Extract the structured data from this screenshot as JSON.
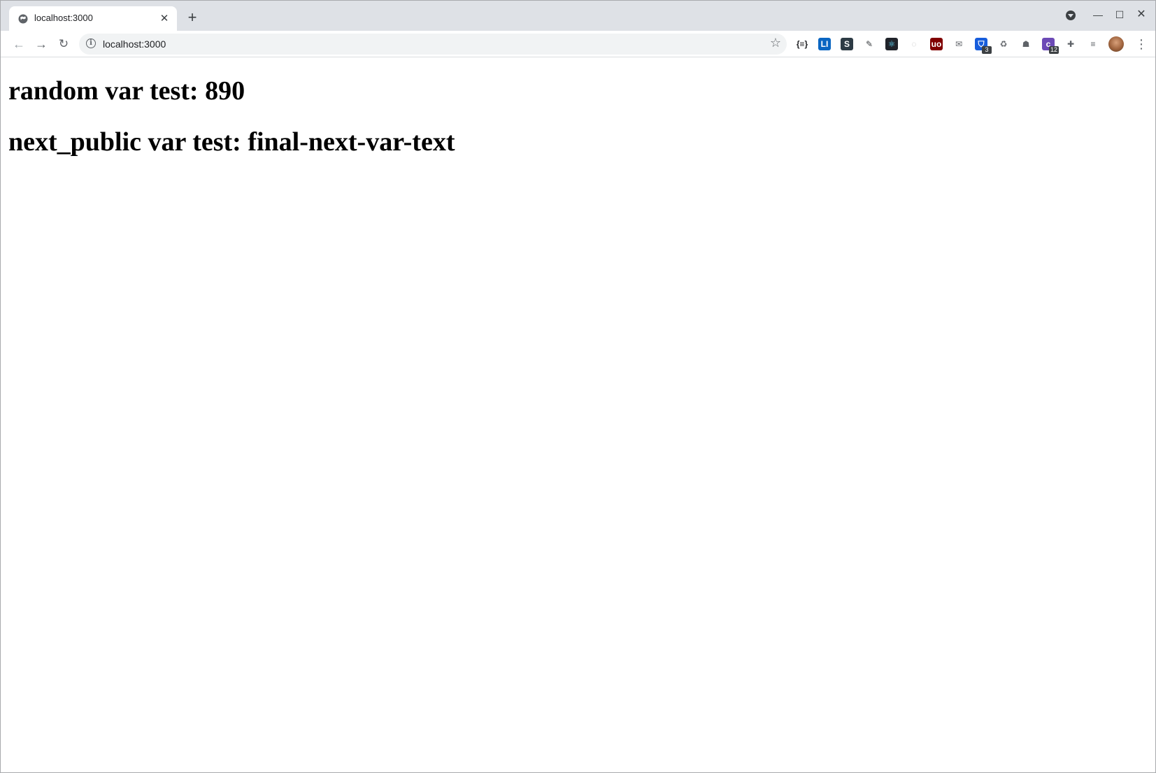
{
  "browser": {
    "tab": {
      "title": "localhost:3000",
      "close_glyph": "✕"
    },
    "new_tab_glyph": "+",
    "window_controls": {
      "minimize_glyph": "—",
      "maximize_glyph": "☐",
      "close_glyph": "✕"
    },
    "toolbar": {
      "back_glyph": "←",
      "forward_glyph": "→",
      "reload_glyph": "↻",
      "url": "localhost:3000",
      "star_glyph": "☆",
      "menu_glyph": "⋮"
    },
    "extensions": [
      {
        "name": "json-viewer-icon",
        "label": "{≡}",
        "bg": "#ffffff",
        "fg": "#202124"
      },
      {
        "name": "li-extension-icon",
        "label": "LI",
        "bg": "#0a66c2",
        "fg": "#ffffff"
      },
      {
        "name": "s-extension-icon",
        "label": "S",
        "bg": "#2d3b45",
        "fg": "#ffffff"
      },
      {
        "name": "dropper-extension-icon",
        "label": "✎",
        "bg": "#ffffff",
        "fg": "#3c4043"
      },
      {
        "name": "react-devtools-icon",
        "label": "⚛",
        "bg": "#20232a",
        "fg": "#61dafb"
      },
      {
        "name": "circle-extension-icon",
        "label": "◌",
        "bg": "#ffffff",
        "fg": "#bdbdbd"
      },
      {
        "name": "ublock-icon",
        "label": "uo",
        "bg": "#800000",
        "fg": "#ffffff"
      },
      {
        "name": "mail-extension-icon",
        "label": "✉",
        "bg": "#ffffff",
        "fg": "#5f6368"
      },
      {
        "name": "bitwarden-icon",
        "label": "⛉",
        "bg": "#175ddc",
        "fg": "#ffffff",
        "badge": "3"
      },
      {
        "name": "handshake-extension-icon",
        "label": "♻",
        "bg": "#ffffff",
        "fg": "#5f6368"
      },
      {
        "name": "hat-extension-icon",
        "label": "☗",
        "bg": "#ffffff",
        "fg": "#5f6368"
      },
      {
        "name": "purple-extension-icon",
        "label": "c",
        "bg": "#6c4ab6",
        "fg": "#ffffff",
        "badge": "12"
      },
      {
        "name": "puzzle-extensions-icon",
        "label": "✚",
        "bg": "#ffffff",
        "fg": "#5f6368"
      },
      {
        "name": "reading-list-icon",
        "label": "≡",
        "bg": "#ffffff",
        "fg": "#5f6368"
      }
    ]
  },
  "page": {
    "heading_random": "random var test: 890",
    "heading_next_public": "next_public var test: final-next-var-text"
  }
}
